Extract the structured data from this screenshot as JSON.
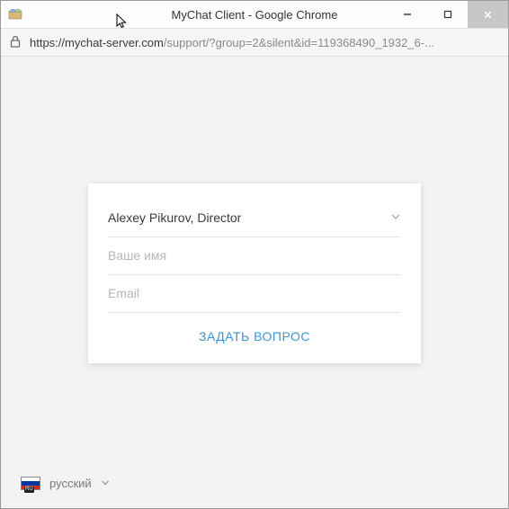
{
  "window": {
    "title": "MyChat Client - Google Chrome"
  },
  "address": {
    "host": "https://mychat-server.com",
    "rest": "/support/?group=2&silent&id=119368490_1932_6-..."
  },
  "form": {
    "operator": "Alexey Pikurov, Director",
    "name_placeholder": "Ваше имя",
    "email_placeholder": "Email",
    "submit_label": "ЗАДАТЬ ВОПРОС"
  },
  "language": {
    "label": "русский",
    "flag_tag": "RU"
  }
}
